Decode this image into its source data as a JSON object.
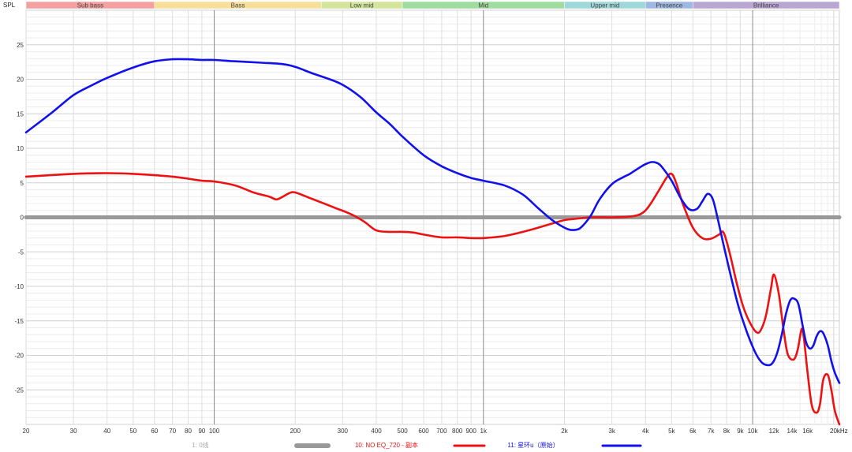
{
  "chart_data": {
    "type": "line",
    "ylabel": "SPL",
    "x_unit_label": "20kHz",
    "xscale": "log",
    "xlim": [
      20,
      21000
    ],
    "ylim": [
      -30,
      30
    ],
    "y_ticks": [
      25,
      20,
      15,
      10,
      5,
      0,
      -5,
      -10,
      -15,
      -20,
      -25
    ],
    "x_ticks": [
      {
        "v": 20,
        "label": "20"
      },
      {
        "v": 30,
        "label": "30"
      },
      {
        "v": 40,
        "label": "40"
      },
      {
        "v": 50,
        "label": "50"
      },
      {
        "v": 60,
        "label": "60"
      },
      {
        "v": 70,
        "label": "70"
      },
      {
        "v": 80,
        "label": "80"
      },
      {
        "v": 90,
        "label": "90"
      },
      {
        "v": 100,
        "label": "100"
      },
      {
        "v": 200,
        "label": "200"
      },
      {
        "v": 300,
        "label": "300"
      },
      {
        "v": 400,
        "label": "400"
      },
      {
        "v": 500,
        "label": "500"
      },
      {
        "v": 600,
        "label": "600"
      },
      {
        "v": 700,
        "label": "700"
      },
      {
        "v": 800,
        "label": "800"
      },
      {
        "v": 900,
        "label": "900"
      },
      {
        "v": 1000,
        "label": "1k"
      },
      {
        "v": 2000,
        "label": "2k"
      },
      {
        "v": 3000,
        "label": "3k"
      },
      {
        "v": 4000,
        "label": "4k"
      },
      {
        "v": 5000,
        "label": "5k"
      },
      {
        "v": 6000,
        "label": "6k"
      },
      {
        "v": 7000,
        "label": "7k"
      },
      {
        "v": 8000,
        "label": "8k"
      },
      {
        "v": 9000,
        "label": "9k"
      },
      {
        "v": 10000,
        "label": "10k"
      },
      {
        "v": 12000,
        "label": "12k"
      },
      {
        "v": 14000,
        "label": "14k"
      },
      {
        "v": 16000,
        "label": "16k"
      }
    ],
    "bands": [
      {
        "label": "Sub bass",
        "from": 20,
        "to": 60,
        "color": "#f4a0a0"
      },
      {
        "label": "Bass",
        "from": 60,
        "to": 250,
        "color": "#f7df9a"
      },
      {
        "label": "Low mid",
        "from": 250,
        "to": 500,
        "color": "#d2e59a"
      },
      {
        "label": "Mid",
        "from": 500,
        "to": 2000,
        "color": "#9fdc9f"
      },
      {
        "label": "Upper mid",
        "from": 2000,
        "to": 4000,
        "color": "#9fd8d8"
      },
      {
        "label": "Presence",
        "from": 4000,
        "to": 6000,
        "color": "#9fb8e2"
      },
      {
        "label": "Brilliance",
        "from": 6000,
        "to": 21000,
        "color": "#b9a6d2"
      }
    ],
    "series": [
      {
        "name": "1: 0线",
        "color": "#999999",
        "x": [
          20,
          21000
        ],
        "y": [
          0,
          0
        ]
      },
      {
        "name": "10: NO EQ_720 - 副本",
        "color": "#ee1111",
        "x": [
          20,
          30,
          40,
          50,
          60,
          70,
          80,
          90,
          100,
          120,
          140,
          160,
          170,
          180,
          190,
          200,
          230,
          280,
          320,
          360,
          400,
          450,
          500,
          550,
          600,
          700,
          800,
          900,
          1000,
          1200,
          1500,
          1800,
          2000,
          2200,
          2500,
          3000,
          3500,
          3800,
          4000,
          4200,
          4500,
          4800,
          5000,
          5200,
          5500,
          6000,
          6500,
          7000,
          7500,
          7800,
          8200,
          8700,
          9200,
          9700,
          10300,
          10700,
          11200,
          11700,
          12000,
          12500,
          13000,
          13500,
          14200,
          14700,
          15200,
          15500,
          16000,
          16600,
          17300,
          17800,
          18300,
          19000,
          19600,
          20200,
          21000
        ],
        "y": [
          5.9,
          6.3,
          6.4,
          6.3,
          6.1,
          5.9,
          5.6,
          5.3,
          5.2,
          4.6,
          3.6,
          3.0,
          2.6,
          3.0,
          3.5,
          3.6,
          2.7,
          1.4,
          0.5,
          -0.6,
          -1.9,
          -2.1,
          -2.1,
          -2.2,
          -2.5,
          -2.9,
          -2.9,
          -3.0,
          -3.0,
          -2.7,
          -1.8,
          -0.9,
          -0.4,
          -0.2,
          0,
          0,
          0.1,
          0.4,
          1.0,
          2.1,
          4.0,
          5.8,
          6.3,
          5.0,
          2.0,
          -1.5,
          -3.0,
          -3.1,
          -2.5,
          -2.2,
          -5.0,
          -9.3,
          -12.8,
          -15.0,
          -16.6,
          -16.4,
          -14.3,
          -10.3,
          -8.3,
          -11.0,
          -16.0,
          -19.8,
          -20.6,
          -19.2,
          -16.2,
          -17.5,
          -22.5,
          -27.3,
          -28.3,
          -27.0,
          -23.5,
          -22.8,
          -25.0,
          -28.0,
          -30.0
        ]
      },
      {
        "name": "11: 星环u（原始）",
        "color": "#1111ee",
        "x": [
          20,
          25,
          30,
          35,
          40,
          50,
          60,
          70,
          80,
          90,
          100,
          120,
          150,
          180,
          200,
          230,
          260,
          300,
          350,
          400,
          450,
          500,
          600,
          700,
          800,
          900,
          1000,
          1200,
          1400,
          1600,
          1800,
          2000,
          2100,
          2200,
          2300,
          2500,
          2700,
          3000,
          3300,
          3500,
          3800,
          4000,
          4200,
          4400,
          4600,
          5000,
          5400,
          5800,
          6200,
          6500,
          6800,
          7100,
          7400,
          7800,
          8300,
          8800,
          9300,
          9800,
          10300,
          10800,
          11300,
          11800,
          12300,
          12800,
          13300,
          13800,
          14300,
          14800,
          15300,
          15800,
          16300,
          16800,
          17300,
          17800,
          18300,
          19000,
          19600,
          20200,
          21000
        ],
        "y": [
          12.3,
          15.2,
          17.7,
          19.1,
          20.2,
          21.7,
          22.6,
          22.9,
          22.9,
          22.8,
          22.8,
          22.6,
          22.4,
          22.2,
          21.8,
          20.9,
          20.2,
          19.2,
          17.4,
          15.2,
          13.5,
          11.7,
          9.0,
          7.4,
          6.4,
          5.7,
          5.3,
          4.6,
          3.3,
          1.3,
          -0.4,
          -1.5,
          -1.8,
          -1.8,
          -1.5,
          0.2,
          2.6,
          4.8,
          5.8,
          6.3,
          7.2,
          7.7,
          8.0,
          7.9,
          7.3,
          5.3,
          2.8,
          1.2,
          1.2,
          2.3,
          3.4,
          2.7,
          0.0,
          -4.0,
          -8.5,
          -12.5,
          -15.5,
          -17.9,
          -19.8,
          -21.0,
          -21.4,
          -21.2,
          -19.8,
          -17.2,
          -14.0,
          -12.0,
          -11.8,
          -12.6,
          -15.5,
          -18.1,
          -19.0,
          -18.6,
          -17.2,
          -16.5,
          -16.8,
          -18.5,
          -20.8,
          -22.5,
          -24.0
        ]
      }
    ]
  }
}
